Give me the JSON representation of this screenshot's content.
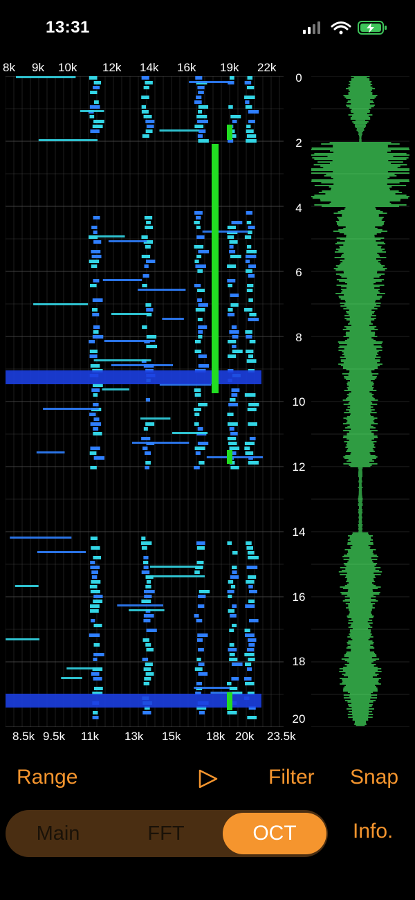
{
  "status_bar": {
    "time": "13:31",
    "icons": [
      "cellular-signal-icon",
      "wifi-icon",
      "battery-charging-icon"
    ]
  },
  "spectrogram": {
    "top_freq_ticks": [
      "8k",
      "9k",
      "10k",
      "12k",
      "14k",
      "16k",
      "19k",
      "22k"
    ],
    "bottom_freq_ticks": [
      "8.5k",
      "9.5k",
      "11k",
      "13k",
      "15k",
      "18k",
      "20k",
      "23.5k"
    ],
    "time_ticks": [
      "0",
      "2",
      "4",
      "6",
      "8",
      "10",
      "12",
      "14",
      "16",
      "18",
      "20"
    ],
    "colors": {
      "background": "#000000",
      "low": "#1c3fe0",
      "mid": "#2f7fff",
      "high": "#33d6e6",
      "peak": "#22dd22"
    }
  },
  "waveform": {
    "color": "#3fcf58"
  },
  "toolbar": {
    "range_label": "Range",
    "play_icon": "play-icon",
    "filter_label": "Filter",
    "snap_label": "Snap"
  },
  "tabs": {
    "main_label": "Main",
    "fft_label": "FFT",
    "oct_label": "OCT",
    "active": "OCT"
  },
  "info_label": "Info.",
  "accent_color": "#f5952e"
}
